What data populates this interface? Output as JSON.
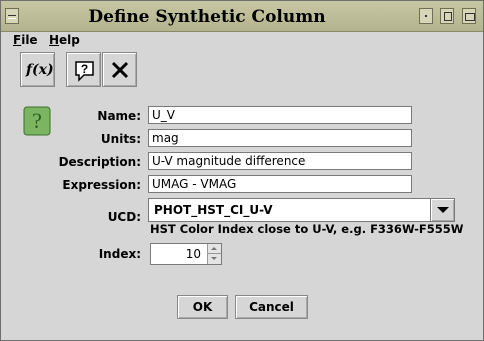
{
  "window": {
    "title": "Define Synthetic Column"
  },
  "menubar": {
    "file": "File",
    "help": "Help"
  },
  "toolbar": {
    "function_label": "f(x)"
  },
  "form": {
    "name_label": "Name:",
    "name_value": "U_V",
    "units_label": "Units:",
    "units_value": "mag",
    "description_label": "Description:",
    "description_value": "U-V magnitude difference",
    "expression_label": "Expression:",
    "expression_value": "UMAG - VMAG",
    "ucd_label": "UCD:",
    "ucd_value": "PHOT_HST_CI_U-V",
    "ucd_description": "HST Color Index close to U-V, e.g. F336W-F555W",
    "index_label": "Index:",
    "index_value": "10"
  },
  "buttons": {
    "ok": "OK",
    "cancel": "Cancel"
  },
  "colors": {
    "titlebar": "#bcbc99",
    "background": "#d6d6d6",
    "help_icon_green": "#5a9a3a"
  }
}
